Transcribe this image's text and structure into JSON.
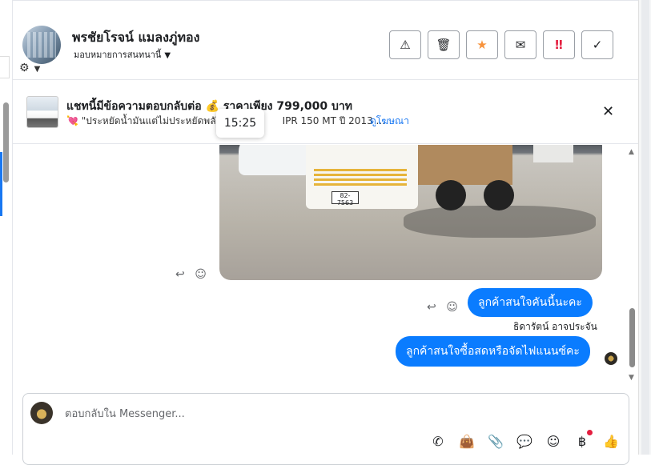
{
  "header": {
    "contact_name": "พรชัยโรจน์ แมลงภู่ทอง",
    "assign_label": "มอบหมายการสนทนานี้",
    "buttons": [
      {
        "icon": "warning-icon",
        "glyph": "⚠"
      },
      {
        "icon": "trash-icon",
        "glyph": "🗑"
      },
      {
        "icon": "star-icon",
        "glyph": "★"
      },
      {
        "icon": "mail-icon",
        "glyph": "✉"
      },
      {
        "icon": "important-icon",
        "glyph": "‼"
      },
      {
        "icon": "check-icon",
        "glyph": "✓"
      }
    ]
  },
  "ad": {
    "title": "แชทนี้มีข้อความตอบกลับต่อ 💰 ราคาเพียง 799,000 บาท",
    "subtitle": "💘 \"ประหยัดน้ำมันแต่ไม่ประหยัดพลัง\"",
    "subtitle_tail": "IPR 150 MT ปี 2013 ...",
    "link": "ดูโฆษณา",
    "tooltip_time": "15:25"
  },
  "messages": [
    {
      "type": "image",
      "alt": "truck photo",
      "plate": "82-7563"
    },
    {
      "type": "text",
      "text": "ลูกค้าสนใจคันนี้นะคะ"
    },
    {
      "type": "sender",
      "text": "ธิดารัตน์ อาจประจัน"
    },
    {
      "type": "text",
      "text": "ลูกค้าสนใจซื้อสดหรือจัดไฟแนนซ์คะ"
    }
  ],
  "composer": {
    "placeholder": "ตอบกลับใน Messenger...",
    "tools": [
      "call-add-icon",
      "bag-icon",
      "attach-icon",
      "chat-bubble-icon",
      "emoji-icon",
      "baht-icon",
      "thumbs-up-icon"
    ]
  },
  "colors": {
    "accent": "#0a7cff",
    "star": "#f7923b",
    "important": "#e41e3f",
    "link": "#1877f2"
  }
}
